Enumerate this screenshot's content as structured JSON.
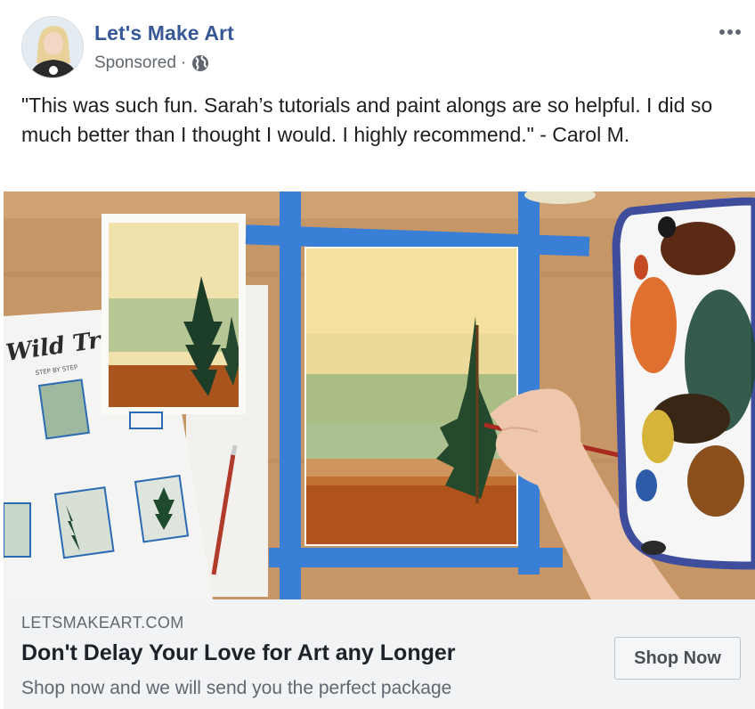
{
  "post": {
    "page_name": "Let's Make Art",
    "sponsored_label": "Sponsored",
    "separator": "·",
    "audience_icon": "globe-icon",
    "more_icon": "more-options-icon",
    "text": "\"This was such fun. Sarah’s tutorials and paint alongs are so helpful. I did so much better than I thought I would. I highly recommend.\" - Carol M."
  },
  "media": {
    "handout_title": "Wild Trees",
    "handout_subtitle": "STEP BY STEP"
  },
  "link_preview": {
    "domain": "LETSMAKEART.COM",
    "headline": "Don't Delay Your Love for Art any Longer",
    "description": "Shop now and we will send you the perfect package",
    "cta_label": "Shop Now"
  },
  "colors": {
    "page_name": "#385898",
    "link_bar_bg": "#f2f3f5",
    "tape_blue": "#3a7fd6"
  }
}
